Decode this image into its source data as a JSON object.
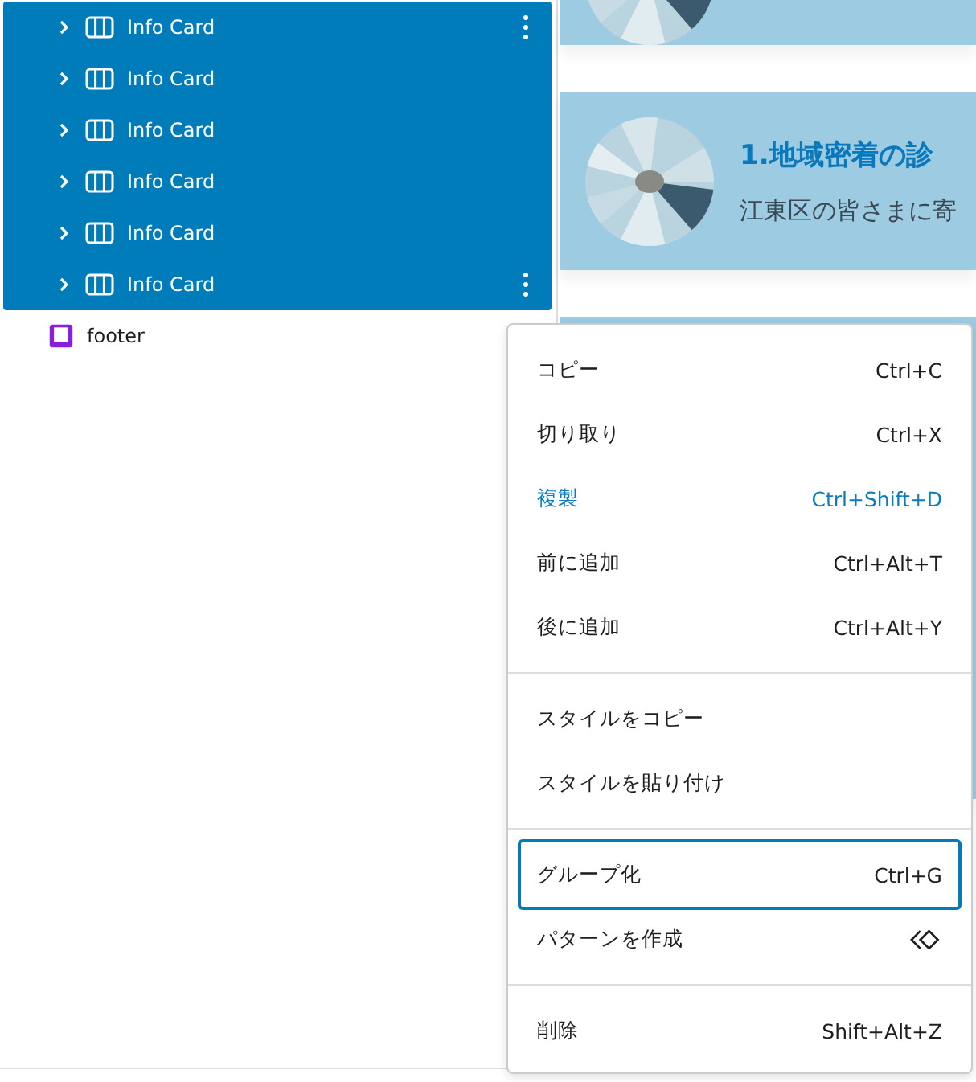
{
  "list_view": {
    "rows": [
      {
        "label": "Info Card",
        "kind": "info-card",
        "selected": true,
        "more_button": true
      },
      {
        "label": "Info Card",
        "kind": "info-card",
        "selected": true,
        "more_button": false
      },
      {
        "label": "Info Card",
        "kind": "info-card",
        "selected": true,
        "more_button": false
      },
      {
        "label": "Info Card",
        "kind": "info-card",
        "selected": true,
        "more_button": false
      },
      {
        "label": "Info Card",
        "kind": "info-card",
        "selected": true,
        "more_button": false
      },
      {
        "label": "Info Card",
        "kind": "info-card",
        "selected": true,
        "more_button": true
      },
      {
        "label": "footer",
        "kind": "footer",
        "selected": false,
        "more_button": false
      }
    ]
  },
  "canvas": {
    "cards": [
      {
        "kind": "picture"
      },
      {
        "kind": "picture",
        "title": "1.地域密着の診",
        "text": "江東区の皆さまに寄"
      },
      {
        "kind": "plain"
      }
    ]
  },
  "context_menu": {
    "groups": [
      [
        {
          "label": "コピー",
          "kind": "shortcut",
          "shortcut": "Ctrl+C",
          "highlighted": false,
          "focused": false
        },
        {
          "label": "切り取り",
          "kind": "shortcut",
          "shortcut": "Ctrl+X",
          "highlighted": false,
          "focused": false
        },
        {
          "label": "複製",
          "kind": "shortcut",
          "shortcut": "Ctrl+Shift+D",
          "highlighted": true,
          "focused": false
        },
        {
          "label": "前に追加",
          "kind": "shortcut",
          "shortcut": "Ctrl+Alt+T",
          "highlighted": false,
          "focused": false
        },
        {
          "label": "後に追加",
          "kind": "shortcut",
          "shortcut": "Ctrl+Alt+Y",
          "highlighted": false,
          "focused": false
        }
      ],
      [
        {
          "label": "スタイルをコピー",
          "kind": "plain",
          "highlighted": false,
          "focused": false
        },
        {
          "label": "スタイルを貼り付け",
          "kind": "plain",
          "highlighted": false,
          "focused": false
        }
      ],
      [
        {
          "label": "グループ化",
          "kind": "shortcut",
          "shortcut": "Ctrl+G",
          "highlighted": false,
          "focused": true
        },
        {
          "label": "パターンを作成",
          "kind": "pattern",
          "highlighted": false,
          "focused": false
        }
      ],
      [
        {
          "label": "削除",
          "kind": "shortcut",
          "shortcut": "Shift+Alt+Z",
          "highlighted": false,
          "focused": false
        }
      ]
    ]
  }
}
